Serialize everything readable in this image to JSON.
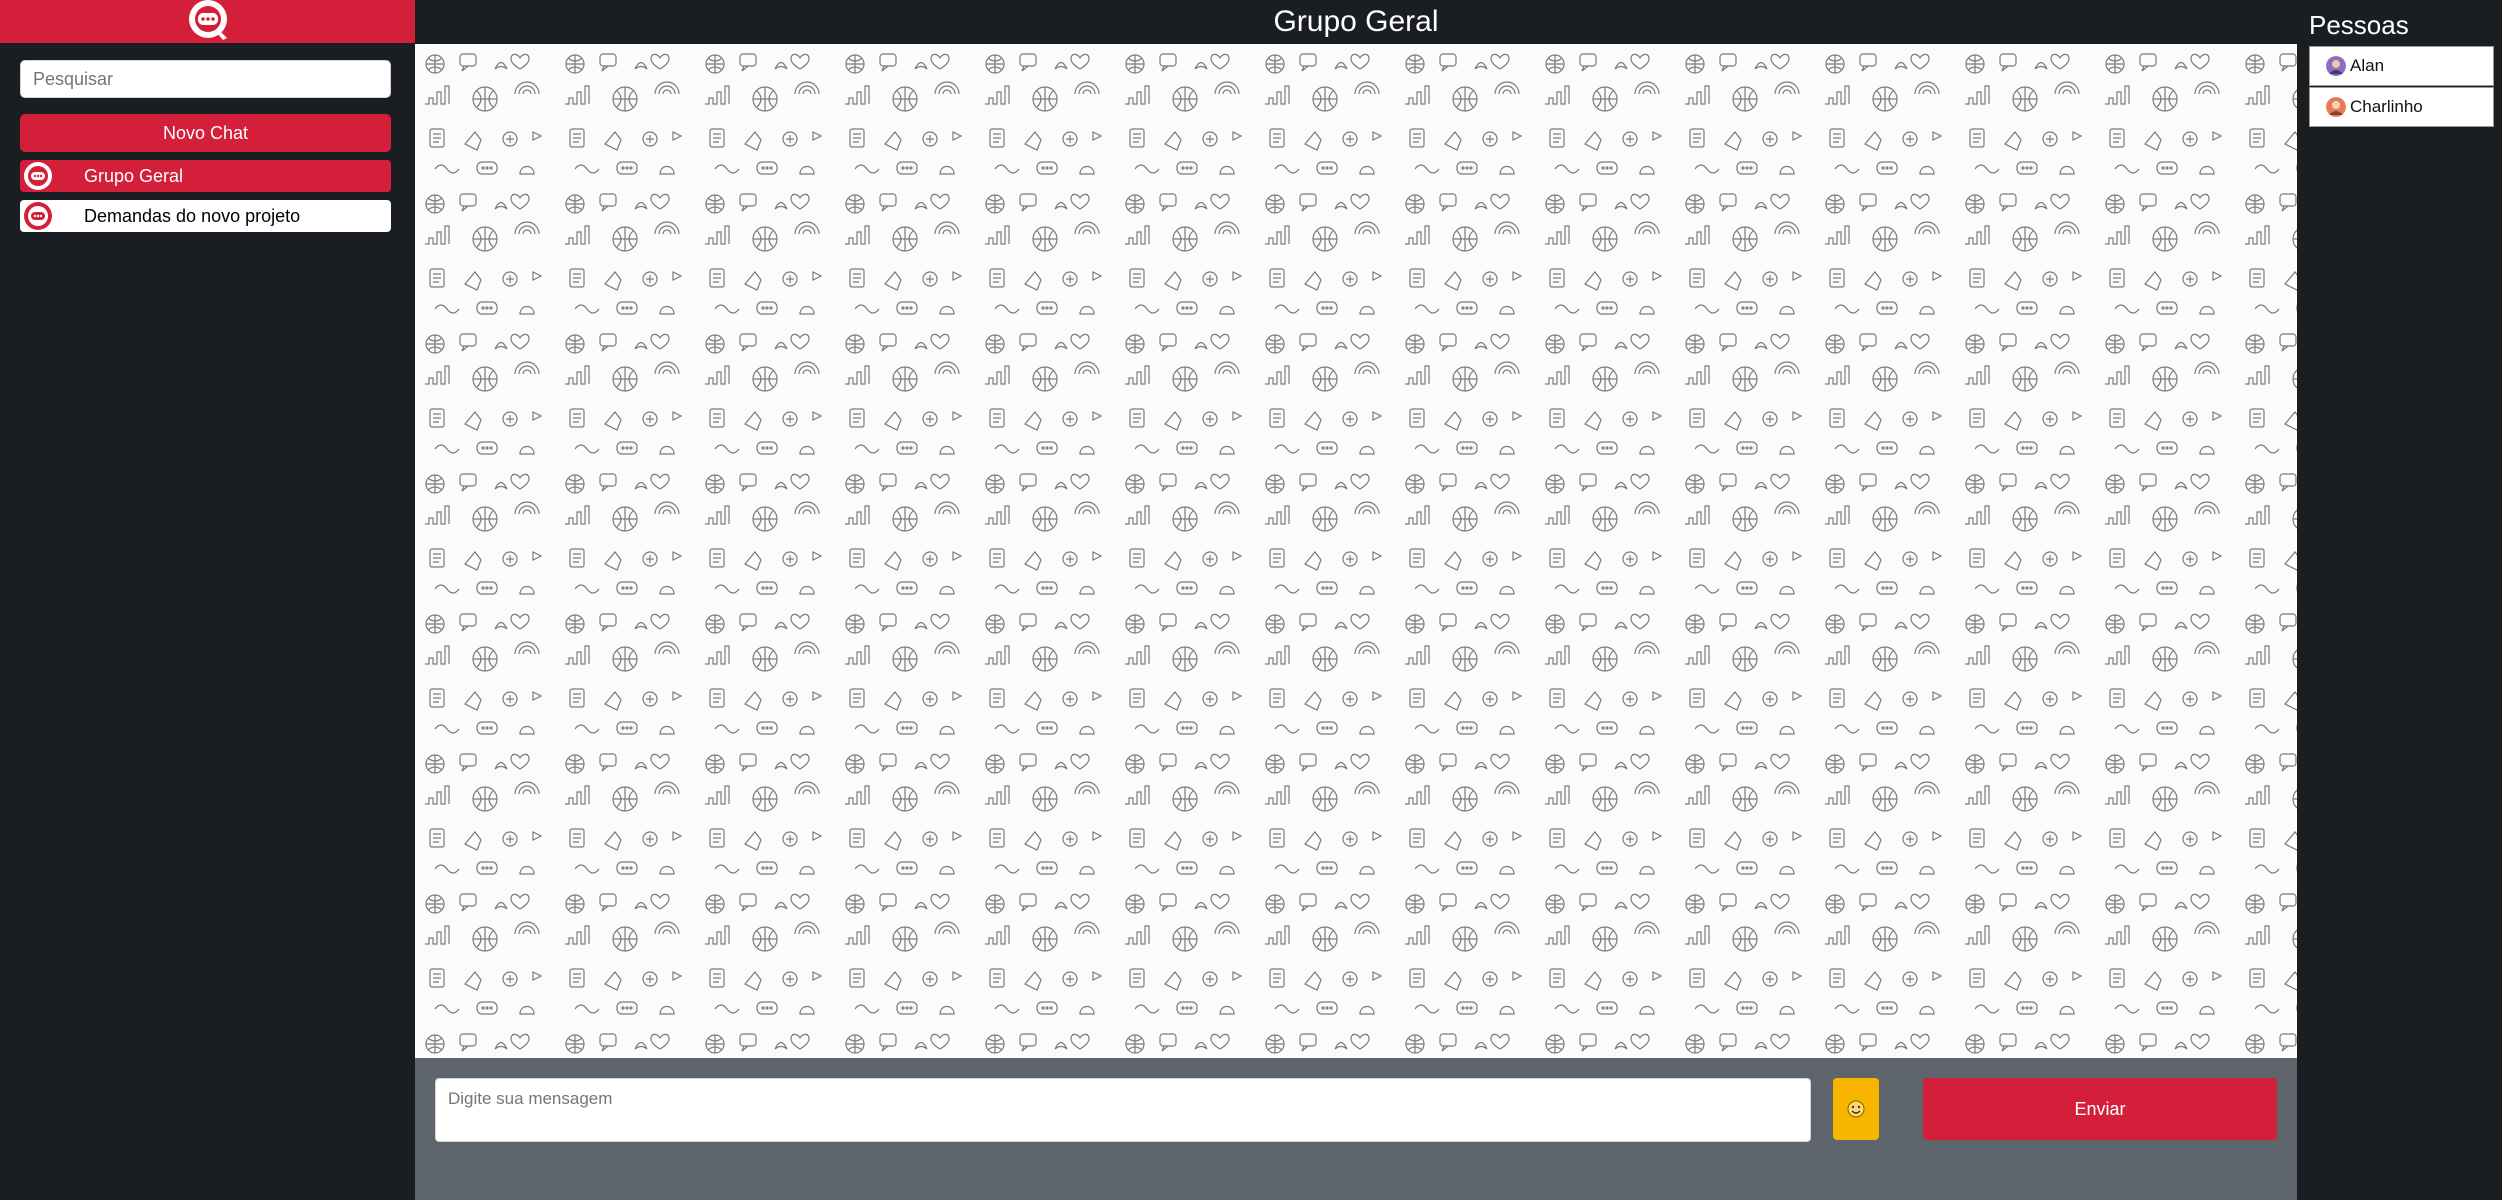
{
  "sidebar": {
    "search_placeholder": "Pesquisar",
    "new_chat_label": "Novo Chat",
    "chats": [
      {
        "label": "Grupo Geral",
        "active": true
      },
      {
        "label": "Demandas do novo projeto",
        "active": false
      }
    ]
  },
  "main": {
    "title": "Grupo Geral",
    "message_placeholder": "Digite sua mensagem",
    "emoji_icon": "smile-emoji-icon",
    "send_label": "Enviar"
  },
  "people": {
    "title": "Pessoas",
    "list": [
      {
        "name": "Alan"
      },
      {
        "name": "Charlinho"
      }
    ]
  },
  "colors": {
    "brand": "#d41f3a",
    "background": "#1a1d21",
    "footer": "#5d646c",
    "emoji_button": "#f7b500"
  }
}
